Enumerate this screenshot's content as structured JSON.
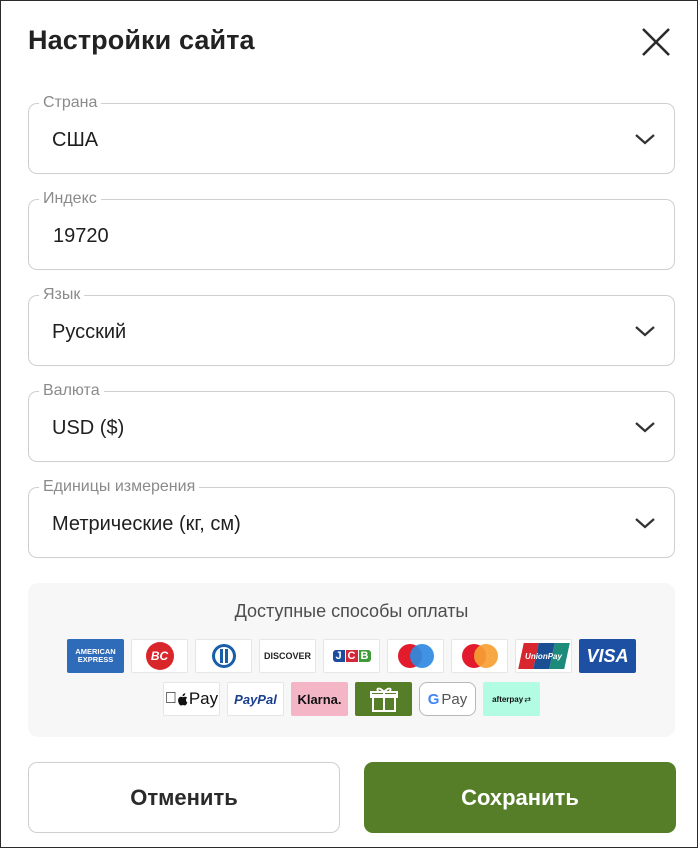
{
  "dialog": {
    "title": "Настройки сайта",
    "close_icon": "close-icon"
  },
  "fields": {
    "country": {
      "label": "Страна",
      "value": "США"
    },
    "zip": {
      "label": "Индекс",
      "value": "19720"
    },
    "language": {
      "label": "Язык",
      "value": "Русский"
    },
    "currency": {
      "label": "Валюта",
      "value": "USD ($)"
    },
    "units": {
      "label": "Единицы измерения",
      "value": "Метрические (кг, см)"
    }
  },
  "payment": {
    "title": "Доступные способы оплаты",
    "methods": [
      {
        "name": "american-express-icon",
        "text": "AMERICAN EXPRESS"
      },
      {
        "name": "bc-card-icon",
        "text": "BC"
      },
      {
        "name": "diners-club-icon"
      },
      {
        "name": "discover-icon",
        "text": "DISCOVER"
      },
      {
        "name": "jcb-icon",
        "text": "JCB"
      },
      {
        "name": "maestro-icon"
      },
      {
        "name": "mastercard-icon"
      },
      {
        "name": "unionpay-icon",
        "text": "UnionPay"
      },
      {
        "name": "visa-icon",
        "text": "VISA"
      },
      {
        "name": "apple-pay-icon",
        "text": "Pay"
      },
      {
        "name": "paypal-icon",
        "text": "PayPal"
      },
      {
        "name": "klarna-icon",
        "text": "Klarna."
      },
      {
        "name": "gift-card-icon"
      },
      {
        "name": "google-pay-icon",
        "text": "Pay"
      },
      {
        "name": "afterpay-icon",
        "text": "afterpay"
      }
    ]
  },
  "buttons": {
    "cancel": "Отменить",
    "save": "Сохранить"
  },
  "colors": {
    "accent": "#567d27",
    "border": "#cfcfcf",
    "label": "#8a8a8a",
    "panel": "#f7f7f7"
  }
}
